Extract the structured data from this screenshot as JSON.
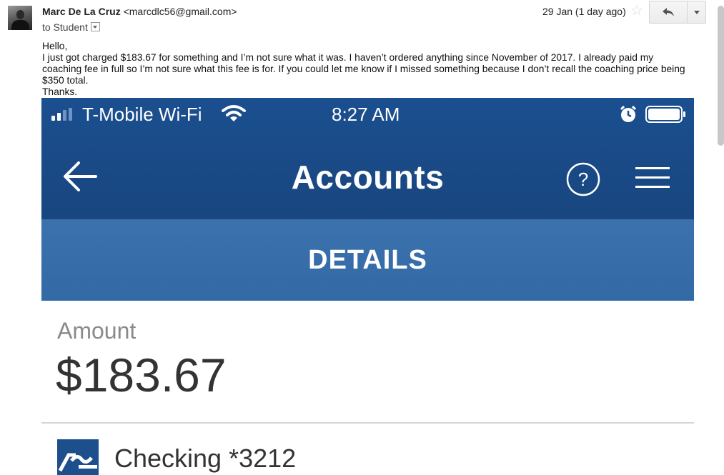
{
  "email": {
    "sender_name": "Marc De La Cruz",
    "sender_email": "<marcdlc56@gmail.com>",
    "to": "to Student",
    "date": "29 Jan (1 day ago)",
    "icons": {
      "star": "star-icon",
      "reply": "reply-icon",
      "more": "chevron-down-icon"
    },
    "body": [
      "Hello,",
      "I just got charged $183.67 for something and I’m not sure what it was. I haven’t ordered anything since November of 2017. I already paid my coaching fee in full so I’m not sure what this fee is for. If you could let me know if I missed something because I don’t recall the coaching price being $350 total.",
      "Thanks."
    ]
  },
  "phone": {
    "status": {
      "carrier": "T-Mobile Wi-Fi",
      "time": "8:27 AM"
    },
    "nav": {
      "title": "Accounts"
    },
    "section": "DETAILS",
    "amount_label": "Amount",
    "amount_value": "$183.67",
    "account": "Checking *3212",
    "colors": {
      "nav_bg": "#1b4f8f",
      "details_bg": "#3b72ad"
    }
  }
}
